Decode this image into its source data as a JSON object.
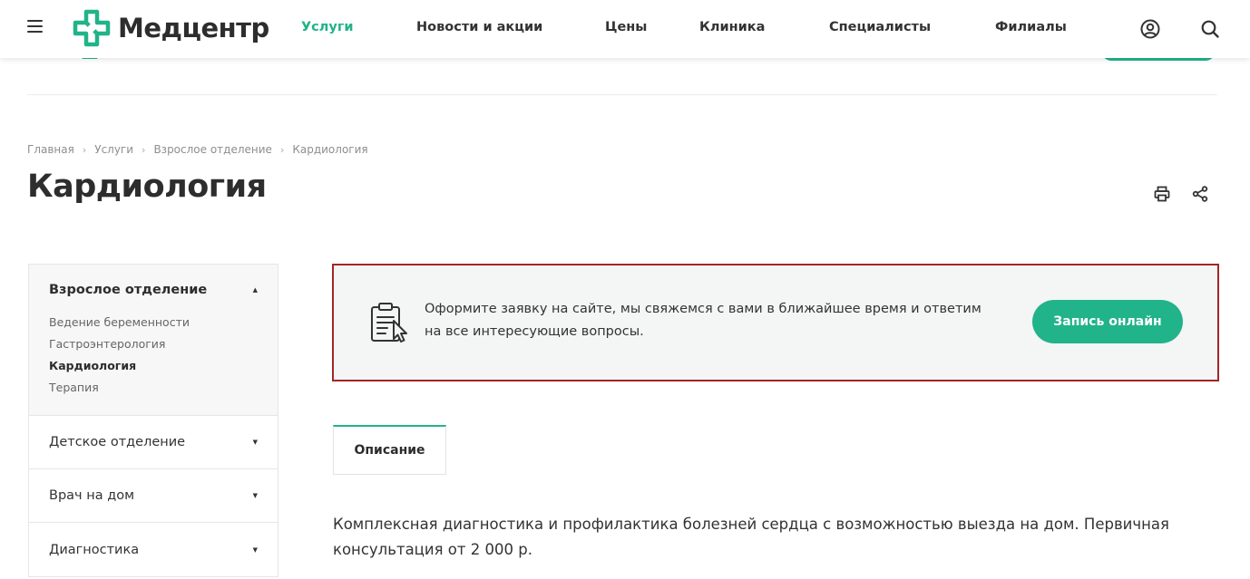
{
  "header": {
    "logo_text": "Медцентр",
    "nav": [
      {
        "label": "Услуги",
        "active": true
      },
      {
        "label": "Новости и акции",
        "active": false
      },
      {
        "label": "Цены",
        "active": false
      },
      {
        "label": "Клиника",
        "active": false
      },
      {
        "label": "Специалисты",
        "active": false
      },
      {
        "label": "Филиалы",
        "active": false
      }
    ],
    "icons": [
      "menu-icon",
      "user-icon",
      "search-icon"
    ]
  },
  "breadcrumb": [
    {
      "label": "Главная"
    },
    {
      "label": "Услуги"
    },
    {
      "label": "Взрослое отделение"
    },
    {
      "label": "Кардиология"
    }
  ],
  "page": {
    "title": "Кардиология",
    "tools": [
      "print-icon",
      "share-icon"
    ]
  },
  "sidebar": {
    "sections": [
      {
        "label": "Взрослое отделение",
        "expanded": true,
        "items": [
          {
            "label": "Ведение беременности",
            "active": false
          },
          {
            "label": "Гастроэнтерология",
            "active": false
          },
          {
            "label": "Кардиология",
            "active": true
          },
          {
            "label": "Терапия",
            "active": false
          }
        ]
      },
      {
        "label": "Детское отделение",
        "expanded": false
      },
      {
        "label": "Врач на дом",
        "expanded": false
      },
      {
        "label": "Диагностика",
        "expanded": false
      }
    ],
    "arrow_up": "▲",
    "arrow_down": "▼"
  },
  "banner": {
    "text_line1": "Оформите заявку на сайте, мы свяжемся с вами в ближайшее время и ответим",
    "text_line2": "на все интересующие вопросы.",
    "button_label": "Запись онлайн",
    "border_color": "#a32626"
  },
  "tabs": [
    {
      "label": "Описание",
      "active": true
    }
  ],
  "description": {
    "text": "Комплексная диагностика и профилактика болезней сердца с возможностью выезда на дом. Первичная консультация от 2 000 р."
  },
  "colors": {
    "accent": "#21b38a",
    "text": "#333333",
    "muted": "#8e8e8e"
  }
}
